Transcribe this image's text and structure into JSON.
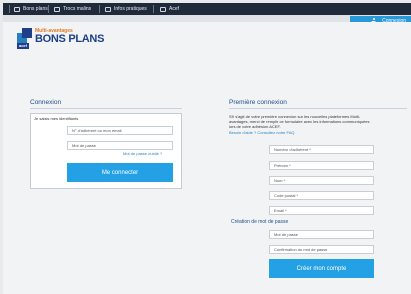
{
  "nav": {
    "items": [
      {
        "label": "Bons plans",
        "icon": "gift-icon"
      },
      {
        "label": "Trocs malins",
        "icon": "exchange-icon"
      },
      {
        "label": "Infos pratiques",
        "icon": "info-icon"
      },
      {
        "label": "Acef",
        "icon": "document-icon"
      }
    ]
  },
  "header": {
    "connect_label": "Connexion",
    "logo": {
      "multi": "Multi-avantages",
      "main": "BONS PLANS",
      "badge": "acef"
    }
  },
  "login": {
    "title": "Connexion",
    "intro": "Je saisis mes identifiants",
    "id_placeholder": "N° d'adhérent ou mon email",
    "password_placeholder": "Mot de passe",
    "forgot_link": "Mot de passe oublié ?",
    "submit_label": "Me connecter"
  },
  "first": {
    "title": "Première connexion",
    "intro_lines": [
      "S'il s'agit de votre première connexion sur les nouvelles plateformes Multi-",
      "avantages, merci de remplir ce formulaire avec les informations communiquées",
      "lors de votre adhésion ACEF."
    ],
    "help_link": "Besoin d'aide ? Consultez notre FAQ",
    "fields": [
      "Numéro d'adhérent *",
      "Prénom *",
      "Nom *",
      "Code postal *",
      "Email *"
    ],
    "password_section_title": "Création de mot de passe",
    "password_fields": [
      "Mot de passe",
      "Confirmation du mot de passe"
    ],
    "submit_label": "Créer mon compte"
  },
  "colors": {
    "accent": "#23a1e4",
    "navbar": "#1f2b3a",
    "title": "#1e4d8c"
  }
}
